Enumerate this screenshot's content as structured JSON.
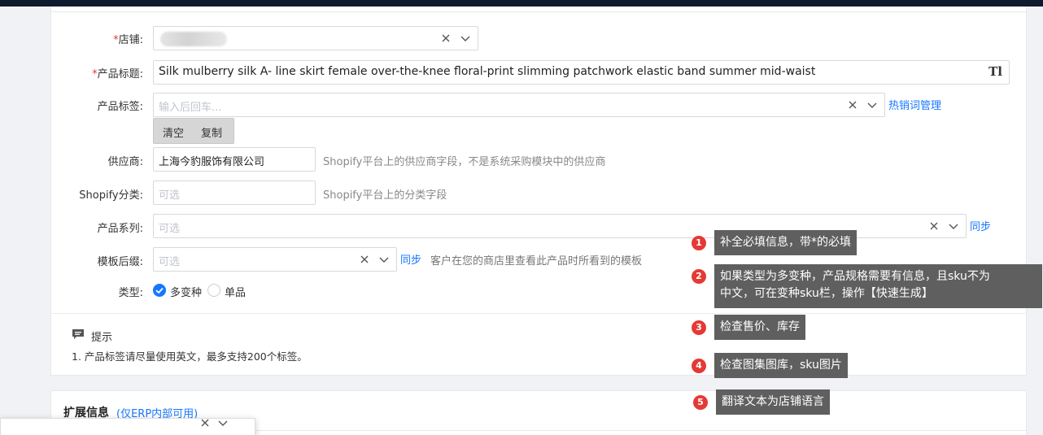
{
  "form": {
    "store": {
      "label_required": "*",
      "label": "店铺:"
    },
    "title": {
      "label_required": "*",
      "label": "产品标题:",
      "value": "Silk mulberry silk A- line skirt female over-the-knee floral-print slimming patchwork elastic band summer mid-waist",
      "icon": "Tl"
    },
    "tags": {
      "label": "产品标签:",
      "placeholder": "输入后回车...",
      "link": "热销词管理",
      "btn_clear": "清空",
      "btn_copy": "复制"
    },
    "vendor": {
      "label": "供应商:",
      "value": "上海今豹服饰有限公司",
      "hint": "Shopify平台上的供应商字段，不是系统采购模块中的供应商"
    },
    "shopify_category": {
      "label": "Shopify分类:",
      "placeholder": "可选",
      "hint": "Shopify平台上的分类字段"
    },
    "series": {
      "label": "产品系列:",
      "placeholder": "可选",
      "link": "同步"
    },
    "template": {
      "label": "模板后缀:",
      "placeholder": "可选",
      "link": "同步",
      "hint": "客户在您的商店里查看此产品时所看到的模板"
    },
    "type": {
      "label": "类型:",
      "option1": "多变种",
      "option2": "单品",
      "selected": "多变种"
    }
  },
  "notice": {
    "title": "提示",
    "text": "1. 产品标签请尽量使用英文，最多支持200个标签。"
  },
  "extended": {
    "title": "扩展信息",
    "subtitle": "(仅ERP内部可用)"
  },
  "tips": [
    {
      "num": "1",
      "text": "补全必填信息，带*的必填"
    },
    {
      "num": "2",
      "line1": "如果类型为多变种，产品规格需要有信息，且sku不为",
      "line2": "中文，可在变种sku栏，操作【快速生成】"
    },
    {
      "num": "3",
      "text": "检查售价、库存"
    },
    {
      "num": "4",
      "text": "检查图集图库，sku图片"
    },
    {
      "num": "5",
      "text": "翻译文本为店铺语言"
    }
  ],
  "colors": {
    "accent": "#1677ff",
    "required": "#e53935",
    "tip_bg": "#5f5f5f"
  }
}
